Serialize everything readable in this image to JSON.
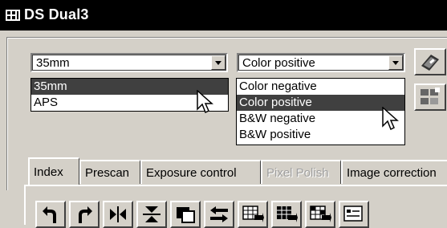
{
  "window": {
    "title": "DS Dual3",
    "icon": "scanner-app-icon"
  },
  "film_size": {
    "selected": "35mm",
    "options": [
      "35mm",
      "APS"
    ],
    "highlighted": "35mm"
  },
  "film_type": {
    "selected": "Color positive",
    "options": [
      "Color negative",
      "Color positive",
      "B&W negative",
      "B&W positive"
    ],
    "highlighted": "Color positive"
  },
  "side_buttons": [
    "eject-film-icon",
    "index-layout-icon"
  ],
  "tabs": [
    {
      "label": "Index",
      "state": "active"
    },
    {
      "label": "Prescan",
      "state": "normal"
    },
    {
      "label": "Exposure control",
      "state": "normal"
    },
    {
      "label": "Pixel Polish",
      "state": "disabled"
    },
    {
      "label": "Image correction",
      "state": "normal"
    }
  ],
  "toolbar": [
    "rotate-left-icon",
    "rotate-right-icon",
    "flip-horizontal-icon",
    "flip-vertical-icon",
    "invert-frames-icon",
    "swap-frames-icon",
    "scan-selected-icon",
    "scan-all-icon",
    "scan-batch-icon",
    "job-settings-icon"
  ]
}
